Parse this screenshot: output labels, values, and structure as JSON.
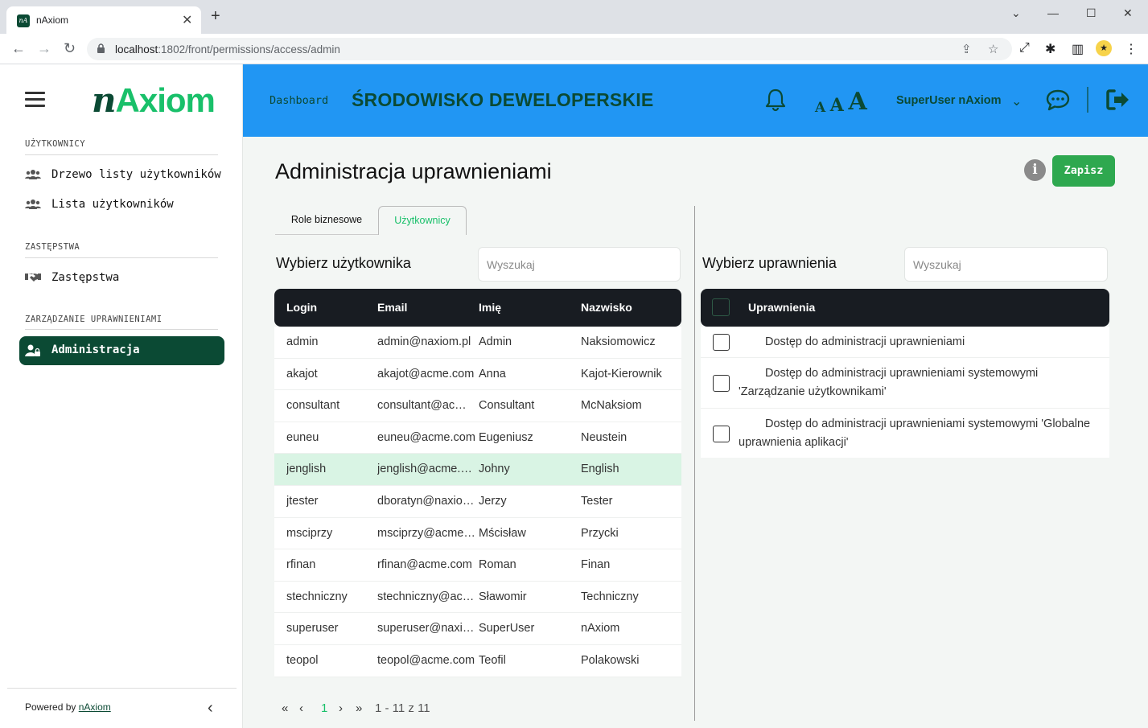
{
  "browser": {
    "tab_title": "nAxiom",
    "favicon_text": "nA",
    "url_host": "localhost",
    "url_path": ":1802/front/permissions/access/admin"
  },
  "sidebar": {
    "logo_n": "n",
    "logo_rest": "Axiom",
    "sections": [
      {
        "title": "UŻYTKOWNICY",
        "items": [
          {
            "label": "Drzewo listy użytkowników",
            "icon": "users-icon"
          },
          {
            "label": "Lista użytkowników",
            "icon": "users-icon"
          }
        ]
      },
      {
        "title": "ZASTĘPSTWA",
        "items": [
          {
            "label": "Zastępstwa",
            "icon": "handshake-icon"
          }
        ]
      },
      {
        "title": "ZARZĄDZANIE UPRAWNIENIAMI",
        "items": [
          {
            "label": "Administracja",
            "icon": "user-lock-icon",
            "active": true
          }
        ]
      }
    ],
    "powered_by": "Powered by",
    "powered_link": "nAxiom"
  },
  "header": {
    "dashboard": "Dashboard",
    "environment": "ŚRODOWISKO DEWELOPERSKIE",
    "font_sizes": [
      "A",
      "A",
      "A"
    ],
    "user": "SuperUser nAxiom",
    "accent": "#2196f3",
    "brand_dark": "#0b4a34"
  },
  "page": {
    "title": "Administracja uprawnieniami",
    "info": "i",
    "save": "Zapisz",
    "tabs": [
      "Role biznesowe",
      "Użytkownicy"
    ],
    "active_tab": 1
  },
  "users": {
    "label": "Wybierz użytkownika",
    "search_placeholder": "Wyszukaj",
    "columns": [
      "Login",
      "Email",
      "Imię",
      "Nazwisko"
    ],
    "rows": [
      [
        "admin",
        "admin@naxiom.pl",
        "Admin",
        "Naksiomowicz"
      ],
      [
        "akajot",
        "akajot@acme.com",
        "Anna",
        "Kajot-Kierownik"
      ],
      [
        "consultant",
        "consultant@acme.com",
        "Consultant",
        "McNaksiom"
      ],
      [
        "euneu",
        "euneu@acme.com",
        "Eugeniusz",
        "Neustein"
      ],
      [
        "jenglish",
        "jenglish@acme.com",
        "Johny",
        "English"
      ],
      [
        "jtester",
        "dboratyn@naxiom.pl",
        "Jerzy",
        "Tester"
      ],
      [
        "msciprzy",
        "msciprzy@acme.com",
        "Mścisław",
        "Przycki"
      ],
      [
        "rfinan",
        "rfinan@acme.com",
        "Roman",
        "Finan"
      ],
      [
        "stechniczny",
        "stechniczny@acme.com",
        "Sławomir",
        "Techniczny"
      ],
      [
        "superuser",
        "superuser@naxiom.pl",
        "SuperUser",
        "nAxiom"
      ],
      [
        "teopol",
        "teopol@acme.com",
        "Teofil",
        "Polakowski"
      ]
    ],
    "selected_row": 4,
    "pager": {
      "first": "«",
      "prev": "‹",
      "page": "1",
      "next": "›",
      "last": "»",
      "summary": "1 - 11 z 11"
    }
  },
  "permissions": {
    "label": "Wybierz uprawnienia",
    "search_placeholder": "Wyszukaj",
    "column": "Uprawnienia",
    "rows": [
      "Dostęp do administracji uprawnieniami",
      "Dostęp do administracji uprawnieniami systemowymi 'Zarządzanie użytkownikami'",
      "Dostęp do administracji uprawnieniami systemowymi 'Globalne uprawnienia aplikacji'"
    ]
  }
}
